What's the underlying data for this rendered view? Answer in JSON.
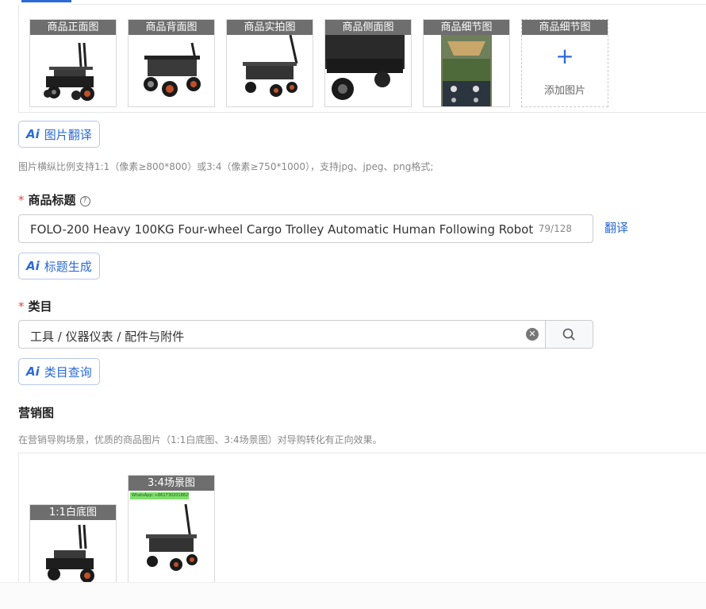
{
  "product_images": [
    {
      "label": "商品正面图"
    },
    {
      "label": "商品背面图"
    },
    {
      "label": "商品实拍图"
    },
    {
      "label": "商品侧面图"
    },
    {
      "label": "商品细节图"
    },
    {
      "label": "商品细节图"
    }
  ],
  "add_image_label": "添加图片",
  "image_translate_label": "图片翻译",
  "image_hint": "图片横纵比例支持1:1（像素≥800*800）或3:4（像素≥750*1000），支持jpg、jpeg、png格式;",
  "title_section": {
    "label": "商品标题",
    "value": "FOLO-200 Heavy  100KG Four-wheel Cargo Trolley Automatic Human Following  Robot",
    "count": "79/128",
    "translate_link": "翻译",
    "generate_label": "标题生成"
  },
  "category_section": {
    "label": "类目",
    "value": "工具 / 仪器仪表 / 配件与附件",
    "query_label": "类目查询"
  },
  "marketing_section": {
    "label": "营销图",
    "hint": "在营销导购场景，优质的商品图片（1:1白底图、3:4场景图）对导购转化有正向效果。",
    "images": [
      {
        "label": "1:1白底图"
      },
      {
        "label": "3:4场景图",
        "watermark": "WhatsApp: +8617302018825"
      }
    ]
  },
  "colors": {
    "accent": "#2b6ad8",
    "required": "#e5483f",
    "tag_bg": "#6e6e6e"
  }
}
